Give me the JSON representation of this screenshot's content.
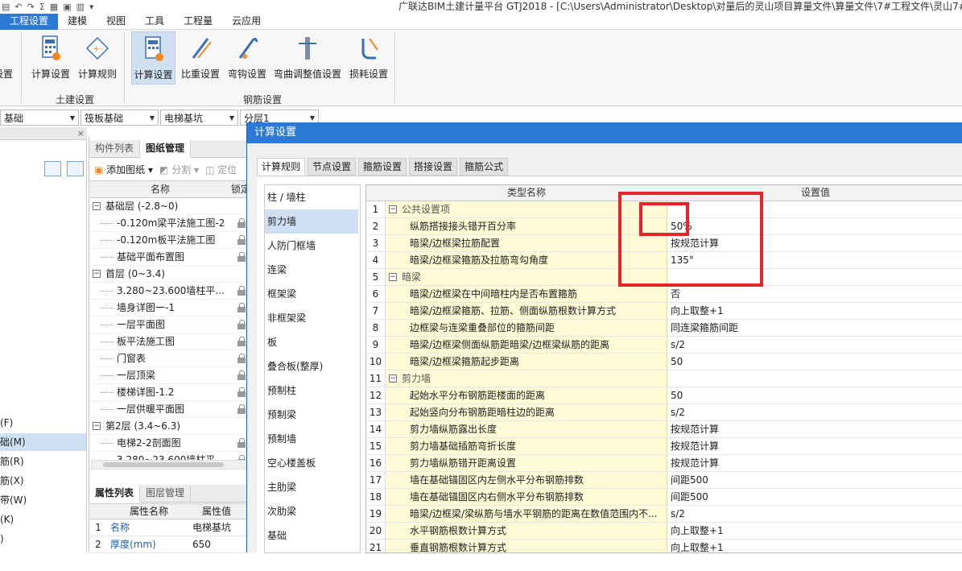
{
  "app_title": "广联达BIM土建计量平台 GTJ2018 - [C:\\Users\\Administrator\\Desktop\\对量后的灵山项目算量文件\\算量文件\\7#工程文件\\灵山7#",
  "menu": [
    "工程设置",
    "建模",
    "视图",
    "工具",
    "工程量",
    "云应用"
  ],
  "ribbon": {
    "partial_left": "设置",
    "tujian": {
      "label": "土建设置",
      "buttons": [
        "计算设置",
        "计算规则"
      ]
    },
    "gangjin": {
      "label": "钢筋设置",
      "buttons": [
        "计算设置",
        "比重设置",
        "弯钩设置",
        "弯曲调整值设置",
        "损耗设置"
      ]
    }
  },
  "combos": [
    "基础",
    "筏板基础",
    "电梯基坑",
    "分层1"
  ],
  "left_panel": {
    "close": "×",
    "items": [
      "(F)",
      "础(M)",
      "筋(R)",
      "筋(X)",
      "带(W)",
      "(K)",
      ")"
    ]
  },
  "mid_panel": {
    "tabs": [
      "构件列表",
      "图纸管理"
    ],
    "toolbar": {
      "add": "添加图纸",
      "split": "分割",
      "locate": "定位"
    },
    "tree_header": [
      "名称",
      "锁定"
    ],
    "tree": [
      {
        "type": "group",
        "label": "基础层 (-2.8~0)"
      },
      {
        "type": "item",
        "label": "-0.120m梁平法施工图-2"
      },
      {
        "type": "item",
        "label": "-0.120m板平法施工图"
      },
      {
        "type": "item",
        "label": "基础平面布置图"
      },
      {
        "type": "group",
        "label": "首层 (0~3.4)"
      },
      {
        "type": "item",
        "label": "3.280~23.600墙柱平..."
      },
      {
        "type": "item",
        "label": "墙身详图一-1"
      },
      {
        "type": "item",
        "label": "一层平面图"
      },
      {
        "type": "item",
        "label": "板平法施工图"
      },
      {
        "type": "item",
        "label": "门窗表"
      },
      {
        "type": "item",
        "label": "一层顶梁"
      },
      {
        "type": "item",
        "label": "楼梯详图-1.2"
      },
      {
        "type": "item",
        "label": "一层供暖平面图"
      },
      {
        "type": "group",
        "label": "第2层 (3.4~6.3)"
      },
      {
        "type": "item",
        "label": "电梯2-2剖面图"
      },
      {
        "type": "item",
        "label": "3.280~23.600墙柱平..."
      }
    ],
    "prop_tabs": [
      "属性列表",
      "图层管理"
    ],
    "prop_header": [
      "属性名称",
      "属性值"
    ],
    "props": [
      {
        "n": "1",
        "name": "名称",
        "value": "电梯基坑"
      },
      {
        "n": "2",
        "name": "厚度(mm)",
        "value": "650"
      }
    ]
  },
  "dialog": {
    "title": "计算设置",
    "tabs": [
      "计算规则",
      "节点设置",
      "箍筋设置",
      "搭接设置",
      "箍筋公式"
    ],
    "categories": [
      "柱 / 墙柱",
      "剪力墙",
      "人防门框墙",
      "连梁",
      "框架梁",
      "非框架梁",
      "板",
      "叠合板(整厚)",
      "预制柱",
      "预制梁",
      "预制墙",
      "空心楼盖板",
      "主肋梁",
      "次肋梁",
      "基础"
    ],
    "selected_category": "剪力墙",
    "grid_header": {
      "name": "类型名称",
      "value": "设置值"
    },
    "rows": [
      {
        "n": "1",
        "kind": "sec",
        "name": "公共设置项",
        "value": ""
      },
      {
        "n": "2",
        "kind": "item",
        "name": "纵筋搭接接头错开百分率",
        "value": "50%"
      },
      {
        "n": "3",
        "kind": "item",
        "name": "暗梁/边框梁拉筋配置",
        "value": "按规范计算"
      },
      {
        "n": "4",
        "kind": "item",
        "name": "暗梁/边框梁箍筋及拉筋弯勾角度",
        "value": "135°"
      },
      {
        "n": "5",
        "kind": "sec",
        "name": "暗梁",
        "value": ""
      },
      {
        "n": "6",
        "kind": "item",
        "name": "暗梁/边框梁在中间暗柱内是否布置箍筋",
        "value": "否"
      },
      {
        "n": "7",
        "kind": "item",
        "name": "暗梁/边框梁箍筋、拉筋、侧面纵筋根数计算方式",
        "value": "向上取整+1"
      },
      {
        "n": "8",
        "kind": "item",
        "name": "边框梁与连梁重叠部位的箍筋间距",
        "value": "同连梁箍筋间距"
      },
      {
        "n": "9",
        "kind": "item",
        "name": "暗梁/边框梁侧面纵筋距暗梁/边框梁纵筋的距离",
        "value": "s/2"
      },
      {
        "n": "10",
        "kind": "item",
        "name": "暗梁/边框梁箍筋起步距离",
        "value": "50"
      },
      {
        "n": "11",
        "kind": "sec",
        "name": "剪力墙",
        "value": ""
      },
      {
        "n": "12",
        "kind": "item",
        "name": "起始水平分布钢筋距楼面的距离",
        "value": "50"
      },
      {
        "n": "13",
        "kind": "item",
        "name": "起始竖向分布钢筋距暗柱边的距离",
        "value": "s/2"
      },
      {
        "n": "14",
        "kind": "item",
        "name": "剪力墙纵筋露出长度",
        "value": "按规范计算"
      },
      {
        "n": "15",
        "kind": "item",
        "name": "剪力墙基础插筋弯折长度",
        "value": "按规范计算"
      },
      {
        "n": "16",
        "kind": "item",
        "name": "剪力墙纵筋错开距离设置",
        "value": "按规范计算"
      },
      {
        "n": "17",
        "kind": "item",
        "name": "墙在基础锚固区内左侧水平分布钢筋排数",
        "value": "间距500"
      },
      {
        "n": "18",
        "kind": "item",
        "name": "墙在基础锚固区内右侧水平分布钢筋排数",
        "value": "间距500"
      },
      {
        "n": "19",
        "kind": "item",
        "name": "暗梁/边框梁/梁纵筋与墙水平钢筋的距离在数值范围内不...",
        "value": "s/2"
      },
      {
        "n": "20",
        "kind": "item",
        "name": "水平钢筋根数计算方式",
        "value": "向上取整+1"
      },
      {
        "n": "21",
        "kind": "item",
        "name": "垂直钢筋根数计算方式",
        "value": "向上取整+1"
      }
    ]
  },
  "colors": {
    "accent": "#2d7ad6",
    "highlight": "#e8232a",
    "name_cell": "#fffbd6",
    "selected": "#cfe0f3"
  }
}
